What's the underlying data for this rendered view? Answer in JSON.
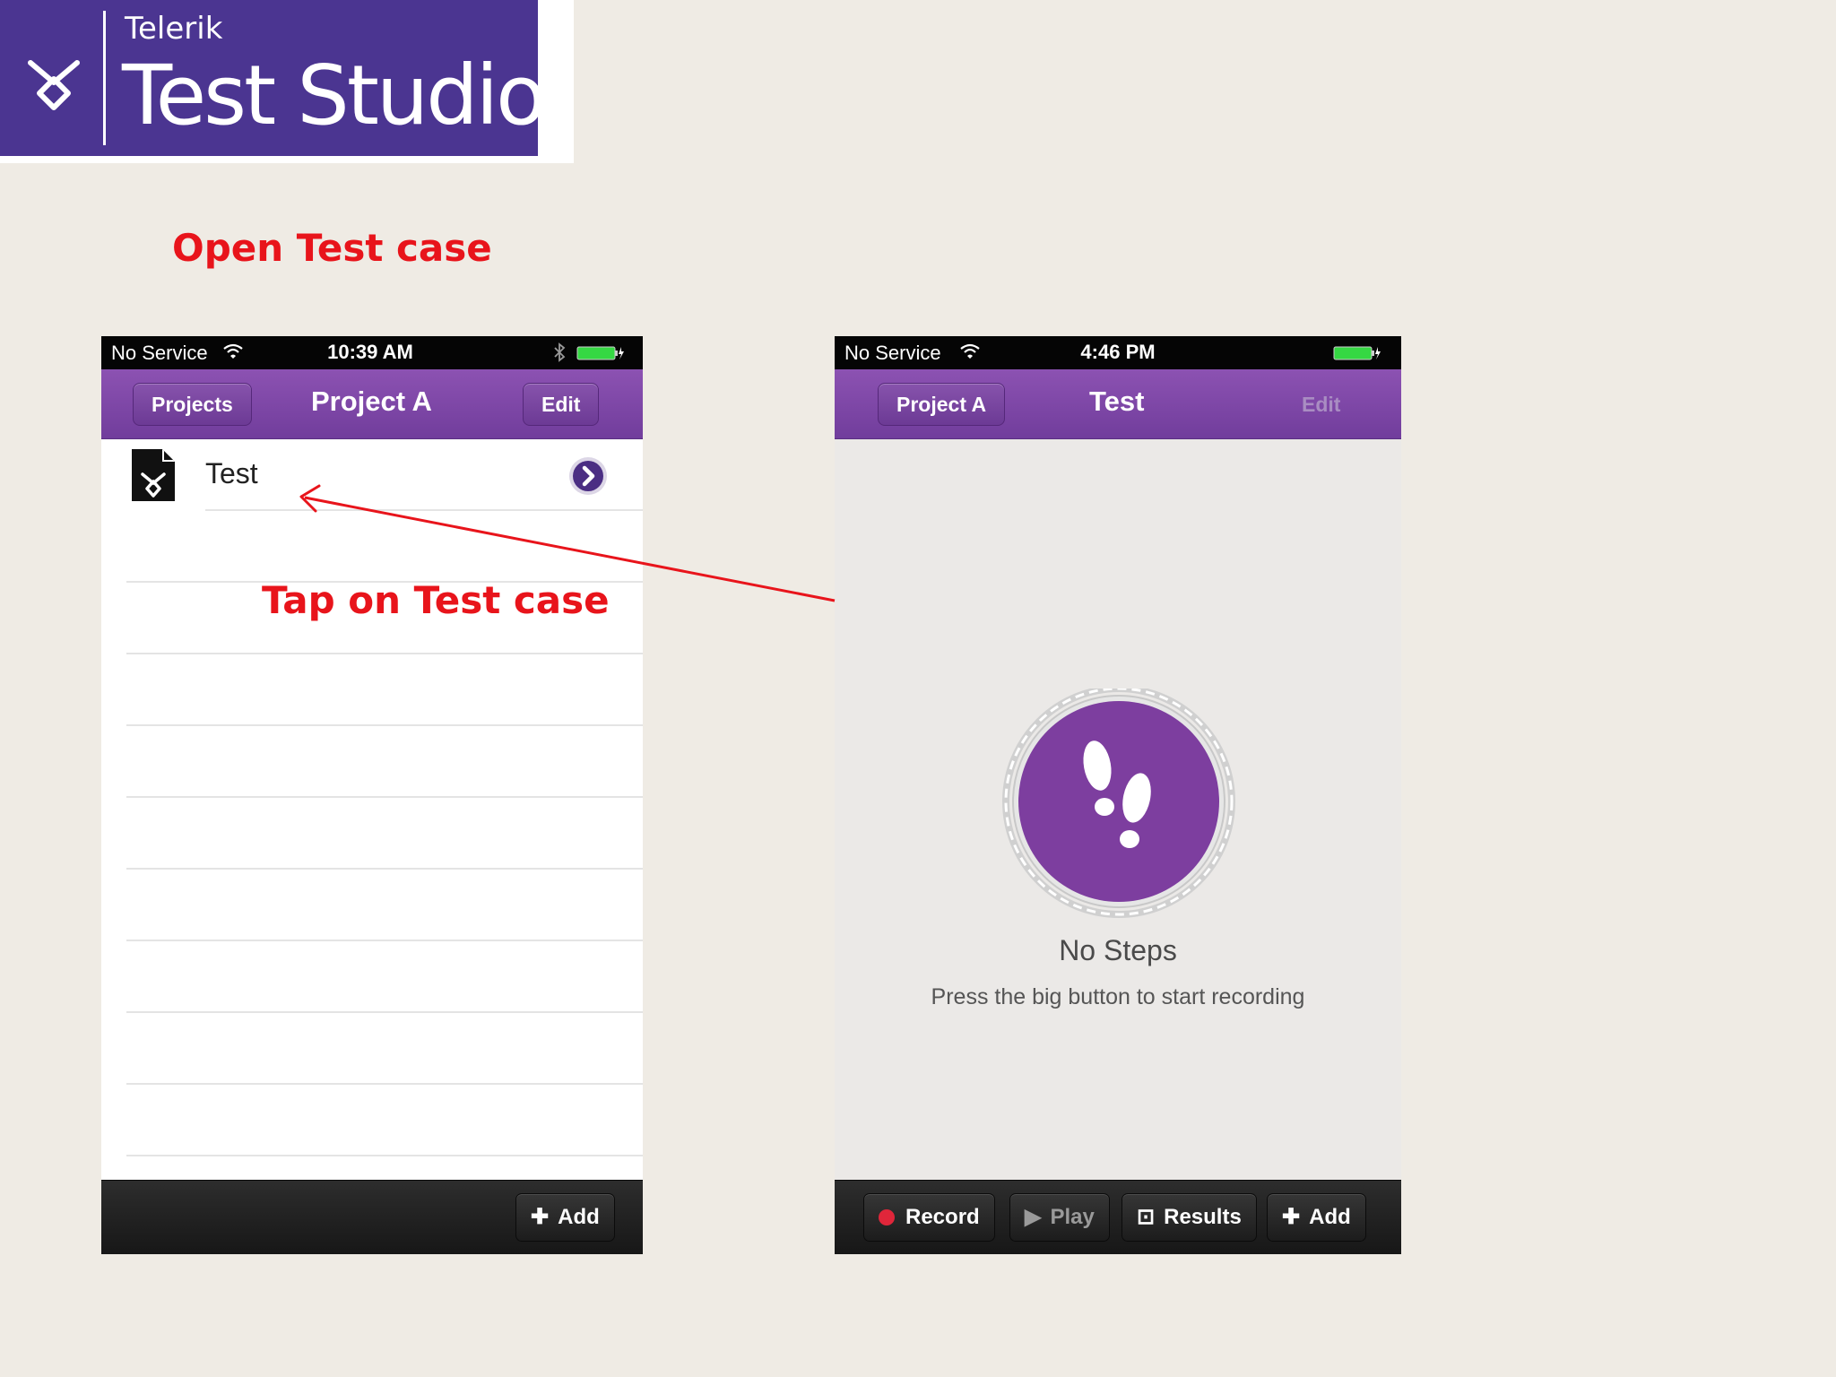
{
  "banner": {
    "brand": "Telerik",
    "product": "Test Studio",
    "colors": {
      "background": "#4b3591",
      "text": "#ffffff"
    },
    "logo_icon": "telerik-logo-icon"
  },
  "annotations": {
    "heading": "Open Test case",
    "instruction": "Tap on Test case",
    "color": "#e8141b",
    "arrow_icon": "arrow-left-icon"
  },
  "phone_left": {
    "status": {
      "carrier": "No Service",
      "time": "10:39 AM"
    },
    "nav": {
      "back": "Projects",
      "title": "Project A",
      "edit": "Edit"
    },
    "list": [
      {
        "label": "Test",
        "icon": "test-file-icon",
        "accessory": "chevron-right-icon"
      }
    ],
    "toolbar": {
      "add": "Add"
    }
  },
  "phone_right": {
    "status": {
      "carrier": "No Service",
      "time": "4:46 PM"
    },
    "nav": {
      "back": "Project A",
      "title": "Test",
      "edit": "Edit"
    },
    "empty_state": {
      "title": "No Steps",
      "hint": "Press the big button to start recording",
      "icon": "footprints-icon"
    },
    "toolbar": {
      "record": "Record",
      "play": "Play",
      "results": "Results",
      "add": "Add"
    }
  },
  "colors": {
    "nav_purple": "#7f47a8",
    "record_red": "#e0263a",
    "battery_green": "#35d843"
  }
}
